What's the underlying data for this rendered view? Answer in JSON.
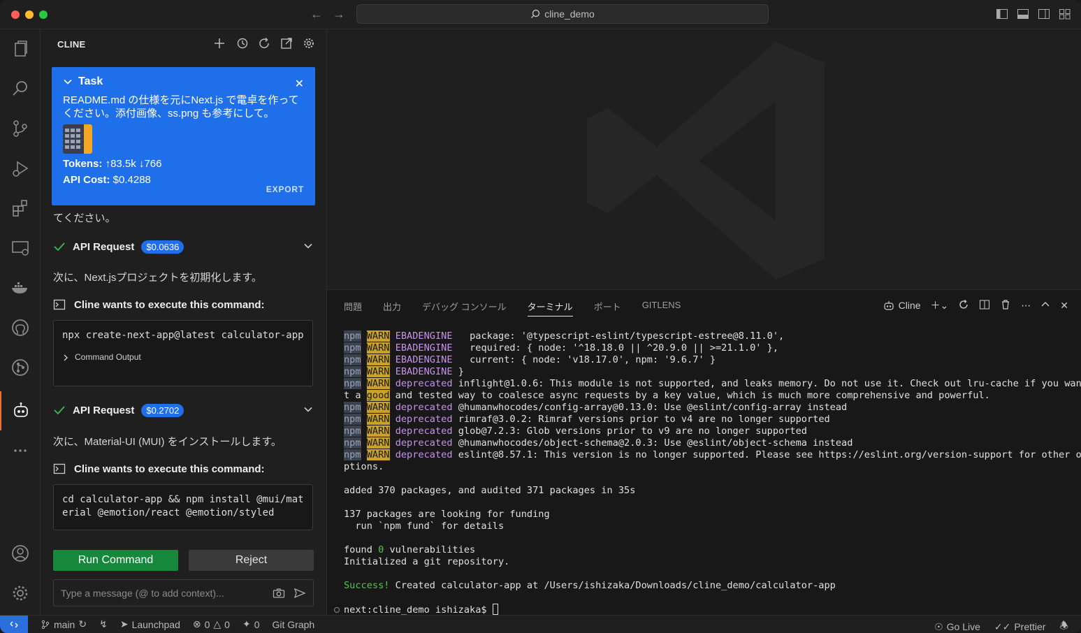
{
  "window": {
    "search": "cline_demo"
  },
  "sidebar": {
    "title": "CLINE",
    "task": {
      "label": "Task",
      "text": "README.md の仕様を元にNext.js で電卓を作ってください。添付画像、ss.png も参考にして。",
      "tokens_label": "Tokens:",
      "tokens_up": "83.5k",
      "tokens_down": "766",
      "cost_label": "API Cost:",
      "cost": "$0.4288",
      "export": "EXPORT"
    },
    "partial_text": "てください。",
    "api_requests": [
      {
        "label": "API Request",
        "cost": "$0.0636"
      },
      {
        "label": "API Request",
        "cost": "$0.2702"
      }
    ],
    "messages": [
      "次に、Next.jsプロジェクトを初期化します。",
      "次に、Material-UI (MUI) をインストールします。"
    ],
    "commands": [
      {
        "label": "Cline wants to execute this command:",
        "code": "npx create-next-app@latest calculator-app",
        "output_label": "Command Output"
      },
      {
        "label": "Cline wants to execute this command:",
        "code": "cd calculator-app && npm install @mui/material @emotion/react @emotion/styled"
      }
    ],
    "run_button": "Run Command",
    "reject_button": "Reject",
    "input_placeholder": "Type a message (@ to add context)..."
  },
  "panel": {
    "tabs": [
      "問題",
      "出力",
      "デバッグ コンソール",
      "ターミナル",
      "ポート",
      "GITLENS"
    ],
    "active_tab": "ターミナル",
    "terminal_name": "Cline",
    "terminal": {
      "warn_lines": [
        {
          "npm": "npm",
          "warn": "WARN",
          "code": "EBADENGINE",
          "rest": "   package: '@typescript-eslint/typescript-estree@8.11.0',"
        },
        {
          "npm": "npm",
          "warn": "WARN",
          "code": "EBADENGINE",
          "rest": "   required: { node: '^18.18.0 || ^20.9.0 || >=21.1.0' },"
        },
        {
          "npm": "npm",
          "warn": "WARN",
          "code": "EBADENGINE",
          "rest": "   current: { node: 'v18.17.0', npm: '9.6.7' }"
        },
        {
          "npm": "npm",
          "warn": "WARN",
          "code": "EBADENGINE",
          "rest": " }"
        },
        {
          "npm": "npm",
          "warn": "WARN",
          "code": "deprecated",
          "rest": " inflight@1.0.6: This module is not supported, and leaks memory. Do not use it. Check out lru-cache if you wan"
        }
      ],
      "wrap_line_1_a": "t a ",
      "wrap_line_1_b": "good",
      "wrap_line_1_c": " and tested way to coalesce async requests by a key value, which is much more comprehensive and powerful.",
      "dep_lines": [
        {
          "npm": "npm",
          "warn": "WARN",
          "code": "deprecated",
          "rest": " @humanwhocodes/config-array@0.13.0: Use @eslint/config-array instead"
        },
        {
          "npm": "npm",
          "warn": "WARN",
          "code": "deprecated",
          "rest": " rimraf@3.0.2: Rimraf versions prior to v4 are no longer supported"
        },
        {
          "npm": "npm",
          "warn": "WARN",
          "code": "deprecated",
          "rest": " glob@7.2.3: Glob versions prior to v9 are no longer supported"
        },
        {
          "npm": "npm",
          "warn": "WARN",
          "code": "deprecated",
          "rest": " @humanwhocodes/object-schema@2.0.3: Use @eslint/object-schema instead"
        },
        {
          "npm": "npm",
          "warn": "WARN",
          "code": "deprecated",
          "rest": " eslint@8.57.1: This version is no longer supported. Please see https://eslint.org/version-support for other o"
        }
      ],
      "wrap_line_2": "ptions.",
      "added": "added 370 packages, and audited 371 packages in 35s",
      "funding1": "137 packages are looking for funding",
      "funding2": "  run `npm fund` for details",
      "found_a": "found ",
      "found_b": "0",
      "found_c": " vulnerabilities",
      "git": "Initialized a git repository.",
      "success_a": "Success!",
      "success_b": " Created calculator-app at /Users/ishizaka/Downloads/cline_demo/calculator-app",
      "prompt": "next:cline_demo ishizaka$ "
    }
  },
  "statusbar": {
    "branch": "main",
    "launchpad": "Launchpad",
    "errors": "0",
    "warnings": "0",
    "ports": "0",
    "git_graph": "Git Graph",
    "go_live": "Go Live",
    "prettier": "Prettier"
  },
  "colors": {
    "accent": "#1f6feb",
    "run": "#16883b",
    "remote": "#2a6fdb"
  }
}
